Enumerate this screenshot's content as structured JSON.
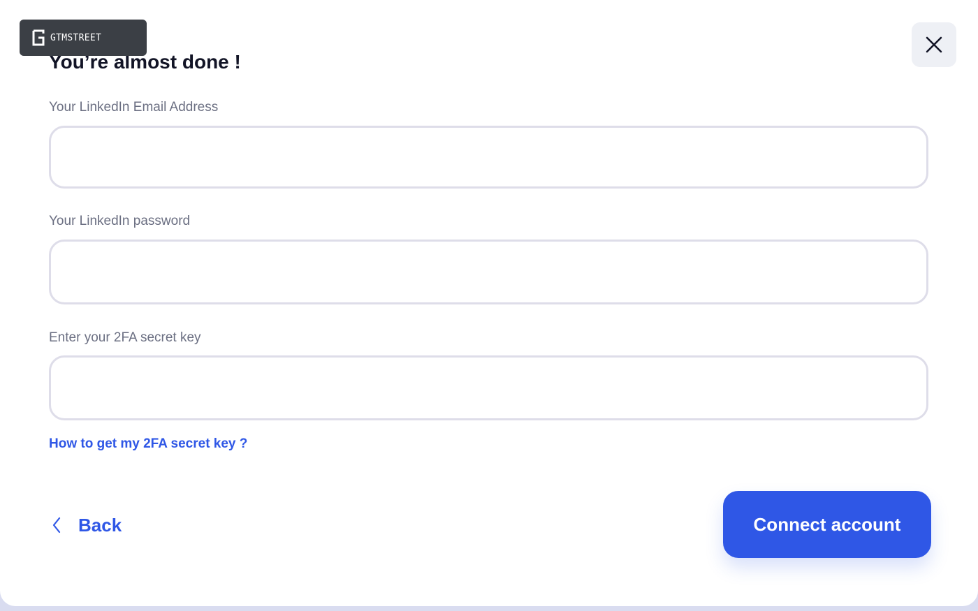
{
  "brand": {
    "name": "GTMSTREET",
    "logo_icon": "g-logo-icon"
  },
  "dialog": {
    "title": "You’re almost done !",
    "close_icon": "close-icon"
  },
  "form": {
    "email": {
      "label": "Your LinkedIn Email Address",
      "value": "",
      "placeholder": ""
    },
    "password": {
      "label": "Your LinkedIn password",
      "value": "",
      "placeholder": ""
    },
    "secret_key": {
      "label": "Enter your 2FA secret key",
      "value": "",
      "placeholder": ""
    },
    "help_link": "How to get my 2FA secret key ?"
  },
  "footer": {
    "back_label": "Back",
    "back_icon": "chevron-left-icon",
    "connect_label": "Connect account"
  },
  "colors": {
    "accent": "#2f57e6",
    "title": "#121426",
    "label": "#6b6f82",
    "input_border": "#dedde9",
    "close_bg": "#eef0f5",
    "badge_bg": "#3b3f45"
  }
}
